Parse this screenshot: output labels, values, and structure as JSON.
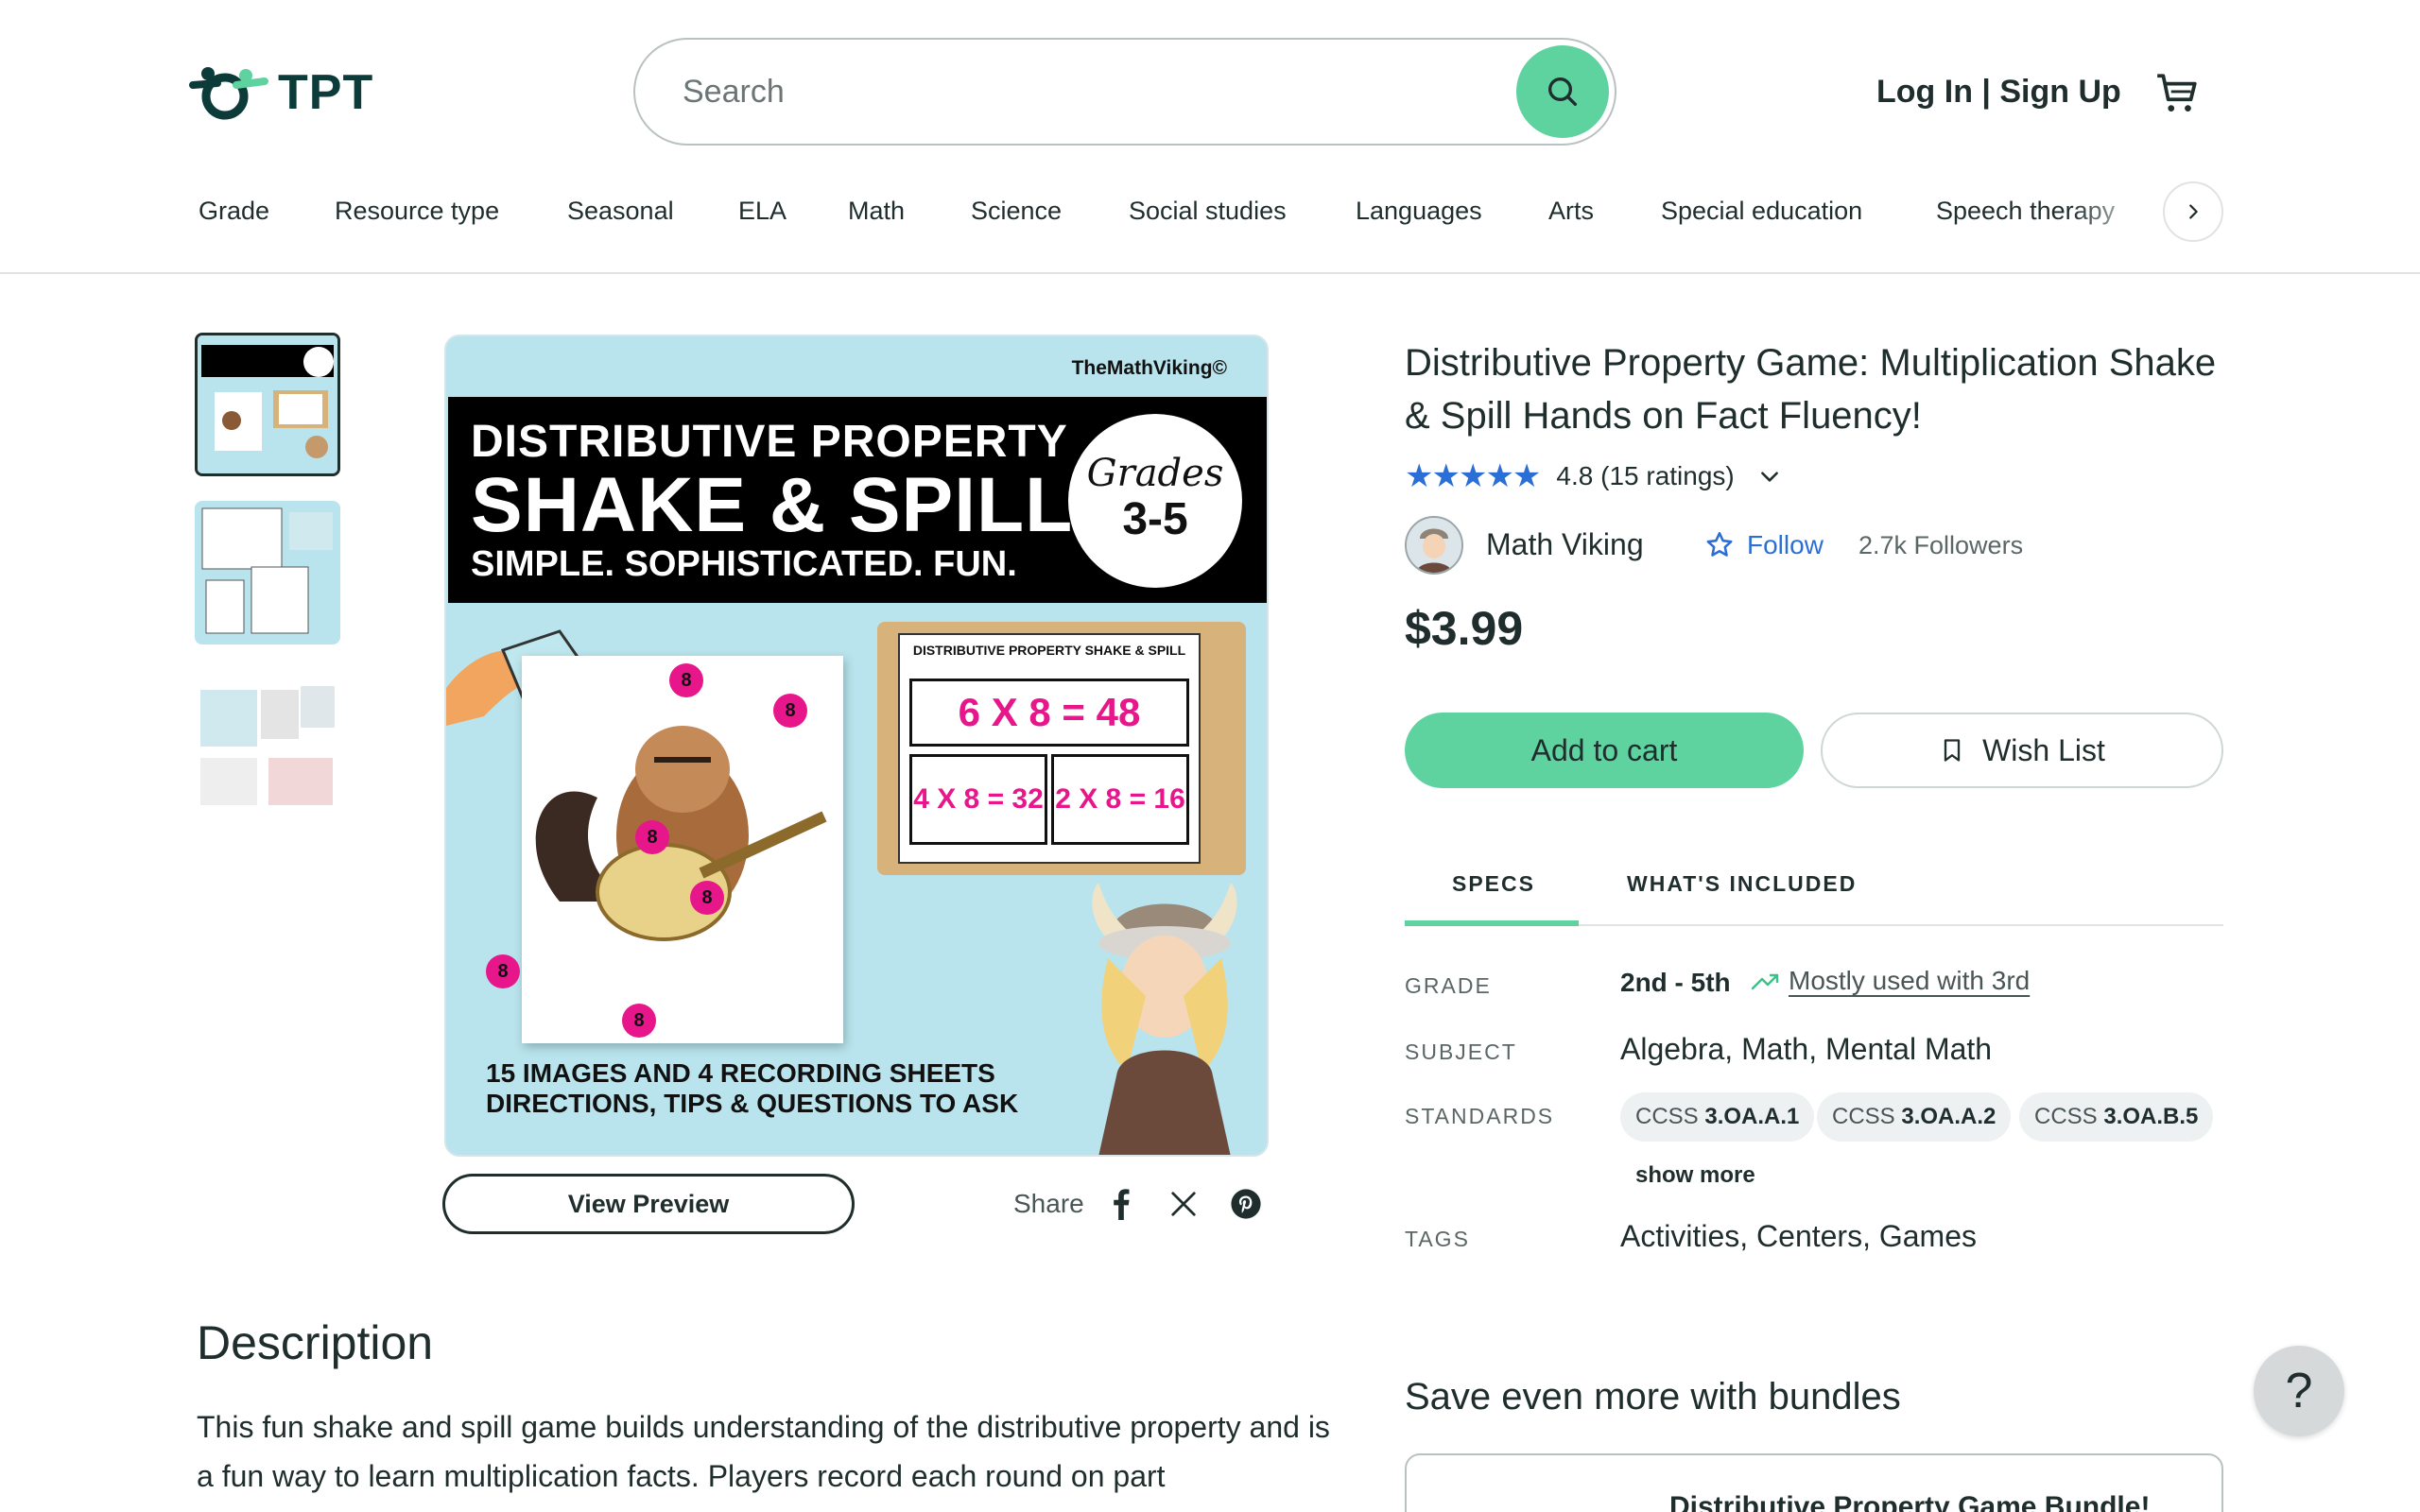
{
  "header": {
    "logo_text": "TPT",
    "search_placeholder": "Search",
    "login_label": "Log In | Sign Up"
  },
  "nav": {
    "items": [
      "Grade",
      "Resource type",
      "Seasonal",
      "ELA",
      "Math",
      "Science",
      "Social studies",
      "Languages",
      "Arts",
      "Special education",
      "Speech therapy"
    ]
  },
  "preview": {
    "brand": "TheMathViking©",
    "line1": "DISTRIBUTIVE PROPERTY",
    "line2": "SHAKE & SPILL",
    "line3": "SIMPLE. SOPHISTICATED. FUN.",
    "badge_top": "Grades",
    "badge_bottom": "3-5",
    "sheet_title": "DISTRIBUTIVE PROPERTY SHAKE & SPILL",
    "eq_main": "6 X 8 = 48",
    "eq_a": "4 X 8 = 32",
    "eq_b": "2 X 8 = 16",
    "dot_label": "8",
    "bottom1": "15 IMAGES AND 4 RECORDING SHEETS",
    "bottom2": "DIRECTIONS, TIPS & QUESTIONS TO ASK",
    "view_preview_label": "View Preview",
    "share_label": "Share"
  },
  "product": {
    "title": "Distributive Property Game: Multiplication Shake & Spill Hands on Fact Fluency!",
    "stars": "★★★★★",
    "rating": "4.8",
    "rating_count": "(15 ratings)",
    "author": "Math Viking",
    "follow_label": "Follow",
    "followers": "2.7k Followers",
    "price": "$3.99",
    "add_to_cart_label": "Add to cart",
    "wishlist_label": "Wish List"
  },
  "tabs": [
    "SPECS",
    "WHAT'S INCLUDED"
  ],
  "specs": {
    "grade_label": "GRADE",
    "grade_value": "2nd - 5th",
    "grade_trend": "Mostly used with 3rd",
    "subject_label": "SUBJECT",
    "subject_value": "Algebra, Math, Mental Math",
    "standards_label": "STANDARDS",
    "standards": [
      {
        "prefix": "CCSS",
        "code": "3.OA.A.1"
      },
      {
        "prefix": "CCSS",
        "code": "3.OA.A.2"
      },
      {
        "prefix": "CCSS",
        "code": "3.OA.B.5"
      }
    ],
    "show_more_label": "show more",
    "tags_label": "TAGS",
    "tags_value": "Activities, Centers, Games"
  },
  "description": {
    "heading": "Description",
    "text": "This fun shake and spill game builds understanding of the distributive property and is a fun way to learn multiplication facts. Players record each round on part"
  },
  "bundles": {
    "heading": "Save even more with bundles",
    "card_title": "Distributive Property Game Bundle!"
  },
  "help_label": "?",
  "colors": {
    "accent_green": "#5ed3a0",
    "star_blue": "#2b6fd6",
    "text_dark": "#1f2d2d"
  }
}
